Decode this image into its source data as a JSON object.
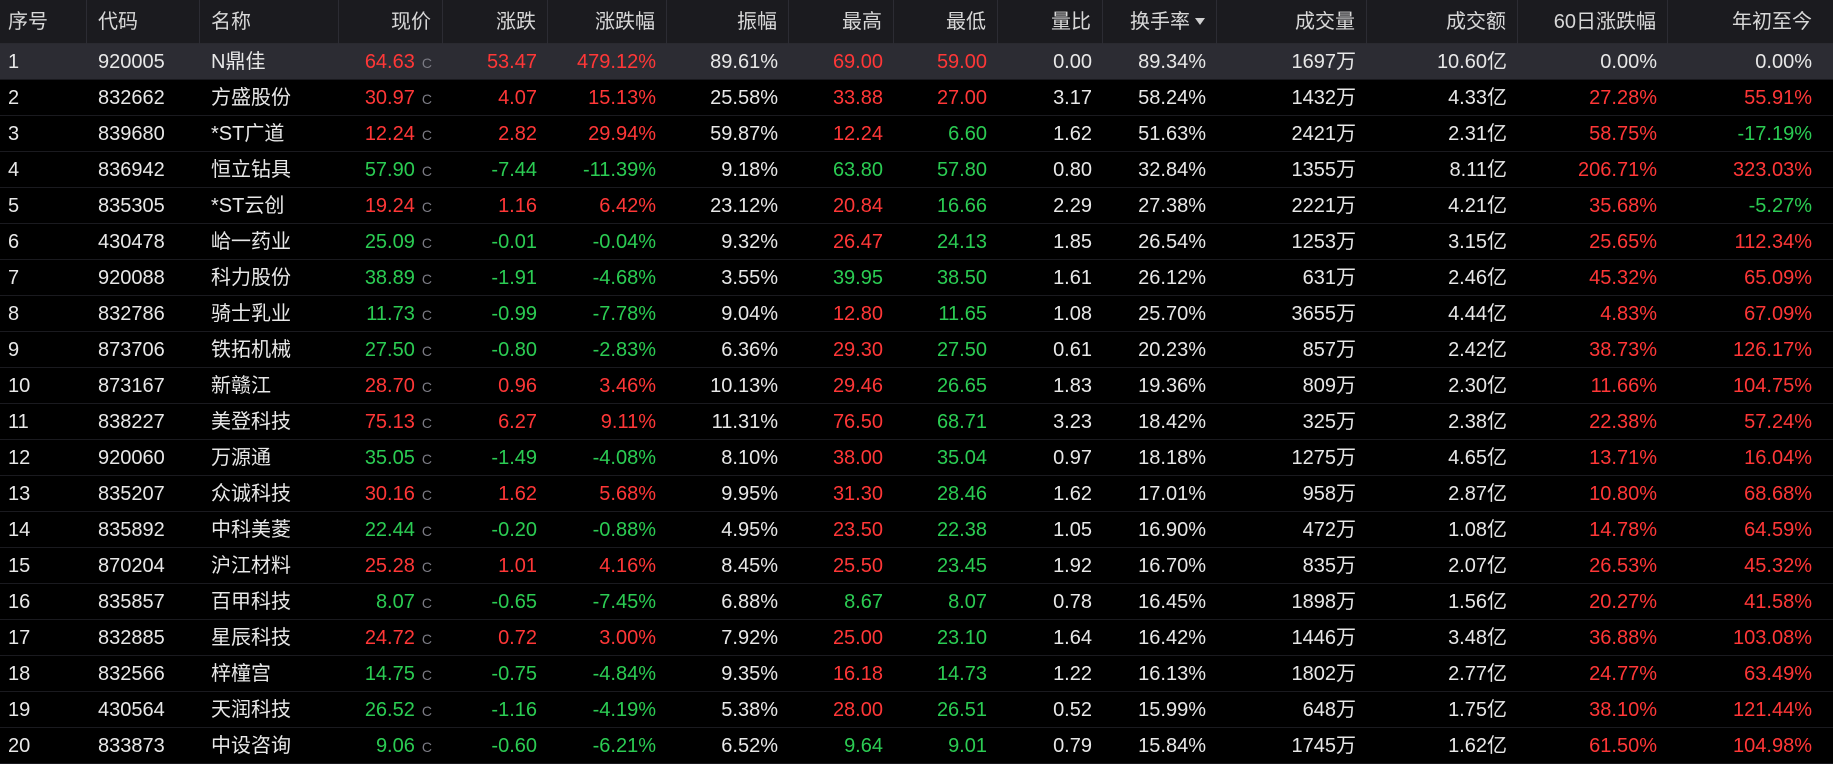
{
  "colors": {
    "background": "#000000",
    "header_bg": "#1b1b1f",
    "selected_row_bg": "#2c2c33",
    "up_red": "#ff3737",
    "down_green": "#2bcc53",
    "neutral_white": "#e8e8e8"
  },
  "sort": {
    "column": "换手率",
    "direction": "desc",
    "icon": "sort-desc-icon"
  },
  "columns": [
    {
      "key": "seq",
      "label": "序号"
    },
    {
      "key": "code",
      "label": "代码"
    },
    {
      "key": "name",
      "label": "名称"
    },
    {
      "key": "price",
      "label": "现价"
    },
    {
      "key": "chg",
      "label": "涨跌"
    },
    {
      "key": "pct",
      "label": "涨跌幅"
    },
    {
      "key": "amp",
      "label": "振幅"
    },
    {
      "key": "high",
      "label": "最高"
    },
    {
      "key": "low",
      "label": "最低"
    },
    {
      "key": "vr",
      "label": "量比"
    },
    {
      "key": "turn",
      "label": "换手率"
    },
    {
      "key": "vol",
      "label": "成交量"
    },
    {
      "key": "amt",
      "label": "成交额"
    },
    {
      "key": "d60",
      "label": "60日涨跌幅"
    },
    {
      "key": "ytd",
      "label": "年初至今"
    }
  ],
  "rows": [
    {
      "seq": "1",
      "code": "920005",
      "name": "N鼎佳",
      "price": "64.63",
      "c": "C",
      "chg": "53.47",
      "pct": "479.12%",
      "amp": "89.61%",
      "high": "69.00",
      "low": "59.00",
      "vr": "0.00",
      "turn": "89.34%",
      "vol": "1697万",
      "amt": "10.60亿",
      "d60": "0.00%",
      "ytd": "0.00%"
    },
    {
      "seq": "2",
      "code": "832662",
      "name": "方盛股份",
      "price": "30.97",
      "c": "C",
      "chg": "4.07",
      "pct": "15.13%",
      "amp": "25.58%",
      "high": "33.88",
      "low": "27.00",
      "vr": "3.17",
      "turn": "58.24%",
      "vol": "1432万",
      "amt": "4.33亿",
      "d60": "27.28%",
      "ytd": "55.91%"
    },
    {
      "seq": "3",
      "code": "839680",
      "name": "*ST广道",
      "price": "12.24",
      "c": "C",
      "chg": "2.82",
      "pct": "29.94%",
      "amp": "59.87%",
      "high": "12.24",
      "low": "6.60",
      "vr": "1.62",
      "turn": "51.63%",
      "vol": "2421万",
      "amt": "2.31亿",
      "d60": "58.75%",
      "ytd": "-17.19%"
    },
    {
      "seq": "4",
      "code": "836942",
      "name": "恒立钻具",
      "price": "57.90",
      "c": "C",
      "chg": "-7.44",
      "pct": "-11.39%",
      "amp": "9.18%",
      "high": "63.80",
      "low": "57.80",
      "vr": "0.80",
      "turn": "32.84%",
      "vol": "1355万",
      "amt": "8.11亿",
      "d60": "206.71%",
      "ytd": "323.03%"
    },
    {
      "seq": "5",
      "code": "835305",
      "name": "*ST云创",
      "price": "19.24",
      "c": "C",
      "chg": "1.16",
      "pct": "6.42%",
      "amp": "23.12%",
      "high": "20.84",
      "low": "16.66",
      "vr": "2.29",
      "turn": "27.38%",
      "vol": "2221万",
      "amt": "4.21亿",
      "d60": "35.68%",
      "ytd": "-5.27%"
    },
    {
      "seq": "6",
      "code": "430478",
      "name": "峆一药业",
      "price": "25.09",
      "c": "C",
      "chg": "-0.01",
      "pct": "-0.04%",
      "amp": "9.32%",
      "high": "26.47",
      "low": "24.13",
      "vr": "1.85",
      "turn": "26.54%",
      "vol": "1253万",
      "amt": "3.15亿",
      "d60": "25.65%",
      "ytd": "112.34%"
    },
    {
      "seq": "7",
      "code": "920088",
      "name": "科力股份",
      "price": "38.89",
      "c": "C",
      "chg": "-1.91",
      "pct": "-4.68%",
      "amp": "3.55%",
      "high": "39.95",
      "low": "38.50",
      "vr": "1.61",
      "turn": "26.12%",
      "vol": "631万",
      "amt": "2.46亿",
      "d60": "45.32%",
      "ytd": "65.09%"
    },
    {
      "seq": "8",
      "code": "832786",
      "name": "骑士乳业",
      "price": "11.73",
      "c": "C",
      "chg": "-0.99",
      "pct": "-7.78%",
      "amp": "9.04%",
      "high": "12.80",
      "low": "11.65",
      "vr": "1.08",
      "turn": "25.70%",
      "vol": "3655万",
      "amt": "4.44亿",
      "d60": "4.83%",
      "ytd": "67.09%"
    },
    {
      "seq": "9",
      "code": "873706",
      "name": "铁拓机械",
      "price": "27.50",
      "c": "C",
      "chg": "-0.80",
      "pct": "-2.83%",
      "amp": "6.36%",
      "high": "29.30",
      "low": "27.50",
      "vr": "0.61",
      "turn": "20.23%",
      "vol": "857万",
      "amt": "2.42亿",
      "d60": "38.73%",
      "ytd": "126.17%"
    },
    {
      "seq": "10",
      "code": "873167",
      "name": "新赣江",
      "price": "28.70",
      "c": "C",
      "chg": "0.96",
      "pct": "3.46%",
      "amp": "10.13%",
      "high": "29.46",
      "low": "26.65",
      "vr": "1.83",
      "turn": "19.36%",
      "vol": "809万",
      "amt": "2.30亿",
      "d60": "11.66%",
      "ytd": "104.75%"
    },
    {
      "seq": "11",
      "code": "838227",
      "name": "美登科技",
      "price": "75.13",
      "c": "C",
      "chg": "6.27",
      "pct": "9.11%",
      "amp": "11.31%",
      "high": "76.50",
      "low": "68.71",
      "vr": "3.23",
      "turn": "18.42%",
      "vol": "325万",
      "amt": "2.38亿",
      "d60": "22.38%",
      "ytd": "57.24%"
    },
    {
      "seq": "12",
      "code": "920060",
      "name": "万源通",
      "price": "35.05",
      "c": "C",
      "chg": "-1.49",
      "pct": "-4.08%",
      "amp": "8.10%",
      "high": "38.00",
      "low": "35.04",
      "vr": "0.97",
      "turn": "18.18%",
      "vol": "1275万",
      "amt": "4.65亿",
      "d60": "13.71%",
      "ytd": "16.04%"
    },
    {
      "seq": "13",
      "code": "835207",
      "name": "众诚科技",
      "price": "30.16",
      "c": "C",
      "chg": "1.62",
      "pct": "5.68%",
      "amp": "9.95%",
      "high": "31.30",
      "low": "28.46",
      "vr": "1.62",
      "turn": "17.01%",
      "vol": "958万",
      "amt": "2.87亿",
      "d60": "10.80%",
      "ytd": "68.68%"
    },
    {
      "seq": "14",
      "code": "835892",
      "name": "中科美菱",
      "price": "22.44",
      "c": "C",
      "chg": "-0.20",
      "pct": "-0.88%",
      "amp": "4.95%",
      "high": "23.50",
      "low": "22.38",
      "vr": "1.05",
      "turn": "16.90%",
      "vol": "472万",
      "amt": "1.08亿",
      "d60": "14.78%",
      "ytd": "64.59%"
    },
    {
      "seq": "15",
      "code": "870204",
      "name": "沪江材料",
      "price": "25.28",
      "c": "C",
      "chg": "1.01",
      "pct": "4.16%",
      "amp": "8.45%",
      "high": "25.50",
      "low": "23.45",
      "vr": "1.92",
      "turn": "16.70%",
      "vol": "835万",
      "amt": "2.07亿",
      "d60": "26.53%",
      "ytd": "45.32%"
    },
    {
      "seq": "16",
      "code": "835857",
      "name": "百甲科技",
      "price": "8.07",
      "c": "C",
      "chg": "-0.65",
      "pct": "-7.45%",
      "amp": "6.88%",
      "high": "8.67",
      "low": "8.07",
      "vr": "0.78",
      "turn": "16.45%",
      "vol": "1898万",
      "amt": "1.56亿",
      "d60": "20.27%",
      "ytd": "41.58%"
    },
    {
      "seq": "17",
      "code": "832885",
      "name": "星辰科技",
      "price": "24.72",
      "c": "C",
      "chg": "0.72",
      "pct": "3.00%",
      "amp": "7.92%",
      "high": "25.00",
      "low": "23.10",
      "vr": "1.64",
      "turn": "16.42%",
      "vol": "1446万",
      "amt": "3.48亿",
      "d60": "36.88%",
      "ytd": "103.08%"
    },
    {
      "seq": "18",
      "code": "832566",
      "name": "梓橦宫",
      "price": "14.75",
      "c": "C",
      "chg": "-0.75",
      "pct": "-4.84%",
      "amp": "9.35%",
      "high": "16.18",
      "low": "14.73",
      "vr": "1.22",
      "turn": "16.13%",
      "vol": "1802万",
      "amt": "2.77亿",
      "d60": "24.77%",
      "ytd": "63.49%"
    },
    {
      "seq": "19",
      "code": "430564",
      "name": "天润科技",
      "price": "26.52",
      "c": "C",
      "chg": "-1.16",
      "pct": "-4.19%",
      "amp": "5.38%",
      "high": "28.00",
      "low": "26.51",
      "vr": "0.52",
      "turn": "15.99%",
      "vol": "648万",
      "amt": "1.75亿",
      "d60": "38.10%",
      "ytd": "121.44%"
    },
    {
      "seq": "20",
      "code": "833873",
      "name": "中设咨询",
      "price": "9.06",
      "c": "C",
      "chg": "-0.60",
      "pct": "-6.21%",
      "amp": "6.52%",
      "high": "9.64",
      "low": "9.01",
      "vr": "0.79",
      "turn": "15.84%",
      "vol": "1745万",
      "amt": "1.62亿",
      "d60": "61.50%",
      "ytd": "104.98%"
    }
  ]
}
